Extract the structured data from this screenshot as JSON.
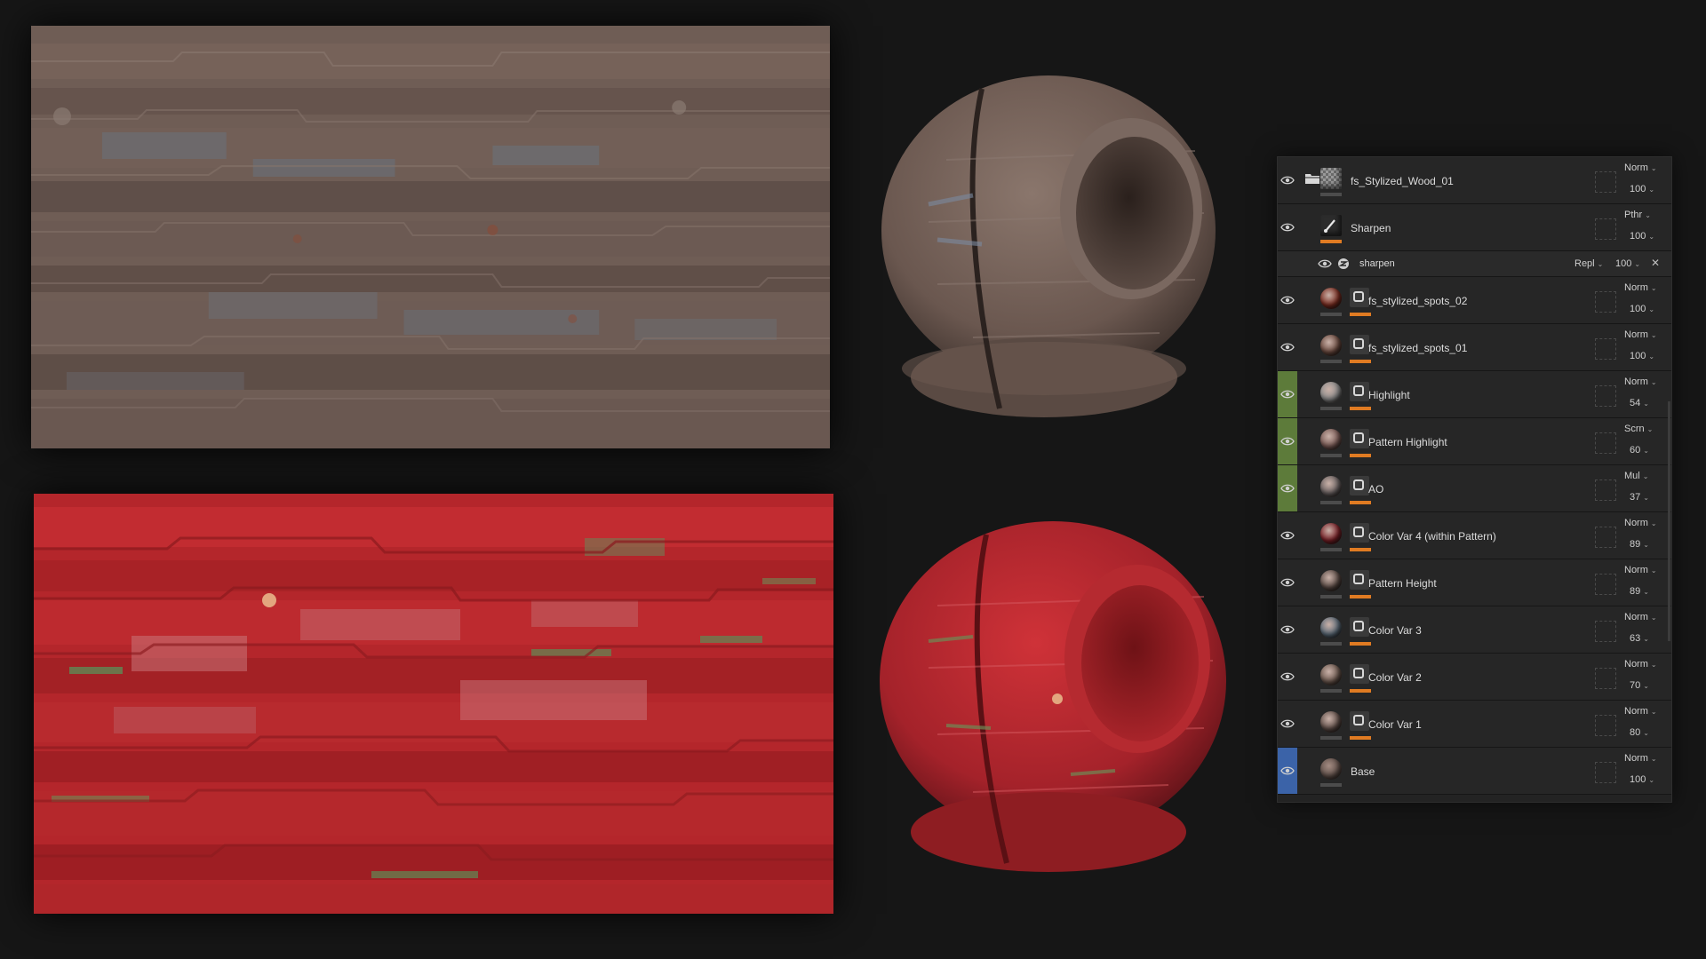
{
  "colors": {
    "background": "#161616",
    "panel": "#232323",
    "accent_orange": "#e07b22",
    "tint_green": "#5d7b3a",
    "tint_blue": "#3b63a8"
  },
  "layers_panel": {
    "rows": [
      {
        "name": "fs_Stylized_Wood_01",
        "blend": "Norm",
        "opacity": "100",
        "type": "folder",
        "tint": "",
        "thumb": "#8a8a8a"
      },
      {
        "name": "Sharpen",
        "blend": "Pthr",
        "opacity": "100",
        "type": "filter",
        "tint": "",
        "thumb": "#2c2c2c"
      },
      {
        "name": "sharpen",
        "blend": "Repl",
        "opacity": "100",
        "type": "effect",
        "tint": "",
        "thumb": ""
      },
      {
        "name": "fs_stylized_spots_02",
        "blend": "Norm",
        "opacity": "100",
        "type": "fill",
        "tint": "",
        "thumb": "#7a2b1f"
      },
      {
        "name": "fs_stylized_spots_01",
        "blend": "Norm",
        "opacity": "100",
        "type": "fill",
        "tint": "",
        "thumb": "#6b4a3f"
      },
      {
        "name": "Highlight",
        "blend": "Norm",
        "opacity": "54",
        "type": "fill",
        "tint": "#5d7b3a",
        "thumb": "#8e8e8e"
      },
      {
        "name": "Pattern Highlight",
        "blend": "Scrn",
        "opacity": "60",
        "type": "fill",
        "tint": "#5d7b3a",
        "thumb": "#7a5a55"
      },
      {
        "name": "AO",
        "blend": "Mul",
        "opacity": "37",
        "type": "fill",
        "tint": "#5d7b3a",
        "thumb": "#6a6262"
      },
      {
        "name": "Color Var 4 (within Pattern)",
        "blend": "Norm",
        "opacity": "89",
        "type": "fill",
        "tint": "",
        "thumb": "#7a1f26"
      },
      {
        "name": "Pattern Height",
        "blend": "Norm",
        "opacity": "89",
        "type": "fill",
        "tint": "",
        "thumb": "#5a4a44"
      },
      {
        "name": "Color Var 3",
        "blend": "Norm",
        "opacity": "63",
        "type": "fill",
        "tint": "",
        "thumb": "#5a6a78"
      },
      {
        "name": "Color Var 2",
        "blend": "Norm",
        "opacity": "70",
        "type": "fill",
        "tint": "",
        "thumb": "#6e5a50"
      },
      {
        "name": "Color Var 1",
        "blend": "Norm",
        "opacity": "80",
        "type": "fill",
        "tint": "",
        "thumb": "#62504a"
      },
      {
        "name": "Base",
        "blend": "Norm",
        "opacity": "100",
        "type": "base",
        "tint": "#3b63a8",
        "thumb": "#5e4e48"
      }
    ]
  }
}
